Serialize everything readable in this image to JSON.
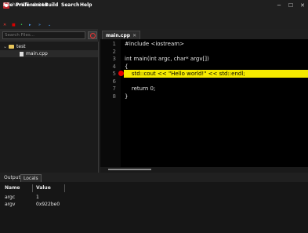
{
  "window": {
    "title": "havIDE v0.04",
    "minimize": "─",
    "maximize": "☐",
    "close": "✕"
  },
  "menu": [
    "File",
    "Preferences",
    "Build",
    "Search",
    "Help"
  ],
  "toolbar": {
    "items": [
      "✕",
      "■",
      "•",
      "▸",
      "»",
      "⌄"
    ],
    "colors": [
      "#ff3b30",
      "#d40000",
      "#39d353",
      "#4da3ff",
      "#4da3ff",
      "#4da3ff"
    ]
  },
  "sidebar": {
    "search_placeholder": "Search Files...",
    "tree": [
      {
        "label": "test",
        "type": "folder",
        "level": 0
      },
      {
        "label": "main.cpp",
        "type": "file",
        "level": 1
      }
    ]
  },
  "editor": {
    "tab": {
      "label": "main.cpp",
      "close": "✕"
    },
    "highlight_color": "#f5ea00",
    "breakpoint_line": 5,
    "lines": [
      {
        "n": "1",
        "text": "#include <iostream>"
      },
      {
        "n": "2",
        "text": ""
      },
      {
        "n": "3",
        "text": "int main(int argc, char* argv[])"
      },
      {
        "n": "4",
        "text": "{"
      },
      {
        "n": "5",
        "text": "    std::cout << \"Hello world!\" << std::endl;"
      },
      {
        "n": "6",
        "text": ""
      },
      {
        "n": "7",
        "text": "    return 0;"
      },
      {
        "n": "8",
        "text": "}"
      }
    ]
  },
  "bottom": {
    "tabs": [
      "Output",
      "Locals"
    ],
    "active_tab": "Locals",
    "columns": [
      "Name",
      "Value"
    ],
    "rows": [
      {
        "name": "argc",
        "value": "1"
      },
      {
        "name": "argv",
        "value": "0x922be0"
      }
    ]
  }
}
